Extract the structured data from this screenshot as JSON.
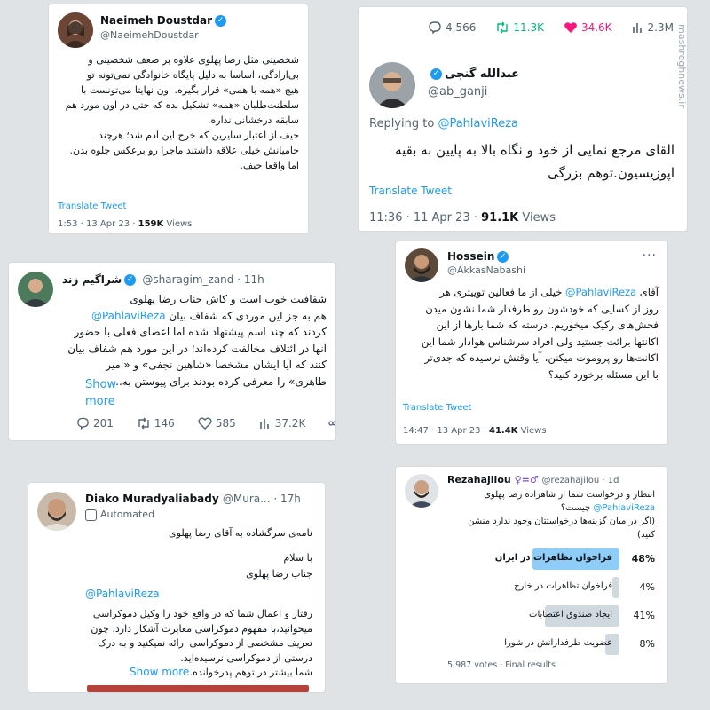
{
  "tweet1": {
    "name": "Naeimeh Doustdar",
    "handle": "@NaeimehDoustdar",
    "lines": [
      "شخصیتی مثل رضا پهلوی علاوه بر ضعف شخصیتی و",
      "بی‌ارادگی، اساسا به دلیل پایگاه خانوادگی نمی‌تونه تو",
      "هیچ «همه با همی» قرار بگیره. اون نهایتا می‌تونست با",
      "سلطنت‌طلبان «همه» تشکیل بده که حتی در اون مورد هم",
      "سابقه درخشانی نداره.",
      "حیف از اعتبار سایرین که خرج این آدم شد؛ هرچند",
      "حامیانش خیلی علاقه داشتند ماجرا رو برعکس جلوه بدن.",
      "اما واقعا حیف."
    ],
    "translate": "Translate Tweet",
    "time": "1:53 · 13 Apr 23 · ",
    "views": "159K",
    "views_label": " Views"
  },
  "tweet2": {
    "stats": {
      "replies": "4,566",
      "retweets": "11.3K",
      "likes": "34.6K",
      "views": "2.3M"
    },
    "name": "عبدالله گنجی",
    "handle": "@ab_ganji",
    "replying_prefix": "Replying to ",
    "replying_to": "@PahlaviReza",
    "lines": [
      "القای مرجع نمایی از خود و نگاه بالا به پایین به بقیه",
      "اپوزیسیون.توهم بزرگی"
    ],
    "translate": "Translate Tweet",
    "time": "11:36 · 11 Apr 23 · ",
    "views": "91.1K",
    "views_label": " Views",
    "watermark": "mashreghnews.ir"
  },
  "tweet3": {
    "name": "شراگیم زند",
    "handle": "@sharagim_zand · 11h",
    "lines": [
      "شفافیت خوب است و کاش جناب رضا پهلوی",
      "هم به جز این موردی که شفاف بیان",
      "کردند که چند اسم پیشنهاد شده اما اعضای فعلی با حضور",
      "آنها در ائتلاف مخالفت کرده‌اند؛ در این مورد هم شفاف بیان",
      "کنند که آیا ایشان مشخصا «شاهین نجفی» و «امیر",
      "طاهری» را معرفی کرده بودند برای پیوستن به..."
    ],
    "mention": "@PahlaviReza",
    "show_more": "Show more",
    "stats": {
      "replies": "201",
      "retweets": "146",
      "likes": "585",
      "views": "37.2K"
    }
  },
  "tweet4": {
    "name": "Hossein",
    "handle": "@AkkasNabashi",
    "mention": "@PahlaviReza",
    "lines": [
      "آقای",
      "خیلی از ما فعالین توییتری هر",
      "روز از کسایی که خودشون رو طرفدار شما نشون میدن",
      "فحش‌های رکیک میخوریم. درسته که شما بارها از این",
      "اکانتها برائت جستید ولی افراد سرشناس هوادار شما این",
      "اکانت‌ها رو پروموت میکنن، آیا وقتش نرسیده که جدی‌تر",
      "با این مسئله برخورد کنید؟"
    ],
    "translate": "Translate Tweet",
    "time": "14:47 · 13 Apr 23 · ",
    "views": "41.4K",
    "views_label": " Views"
  },
  "tweet5": {
    "name": "Diako Muradyaliabady",
    "handle": "@Mura... · 17h",
    "automated": "Automated",
    "title": "نامه‌ی سرگشاده به آقای رضا پهلوی",
    "greeting": "با سلام",
    "salutation": "جناب  رضا پهلوی",
    "mention": "@PahlaviReza",
    "lines": [
      "رفتار و اعمال شما که در واقع خود را وکیل دموکراسی",
      "میخوانید،با مفهوم دموکراسی مغایرت آشکار دارد. چون",
      "تعریف مشخصی از دموکراسی ارائه نمیکنید و به درک",
      "درستی از دموکراسی  نرسیده‌اید.",
      "شما بیشتر در توهم پدرخوانده..."
    ],
    "show_more": "Show more"
  },
  "tweet6": {
    "name": "Rezahajilou",
    "handle": "@rezahajilou · 1d",
    "lines": [
      "انتظار و درخواست شما از شاهزاده رضا پهلوی",
      "چیست؟",
      "(اگر در میان گزینه‌ها درخواستتان وجود ندارد منشن",
      "کنید)"
    ],
    "mention": "@PahlaviReza",
    "poll": [
      {
        "label": "فراخوان تظاهرات در ایران",
        "pct": "48%",
        "value": 48,
        "win": true
      },
      {
        "label": "فراخوان تظاهرات در خارج",
        "pct": "4%",
        "value": 4,
        "win": false
      },
      {
        "label": "ایجاد صندوق اعتصابات",
        "pct": "41%",
        "value": 41,
        "win": false
      },
      {
        "label": "عضویت طرفدارانش در شورا",
        "pct": "8%",
        "value": 8,
        "win": false
      }
    ],
    "votes": "5,987 votes · Final results"
  },
  "colors": {
    "accent": "#1d9bf0",
    "like": "#f91880",
    "retweet": "#00ba7c",
    "muted": "#536471"
  }
}
